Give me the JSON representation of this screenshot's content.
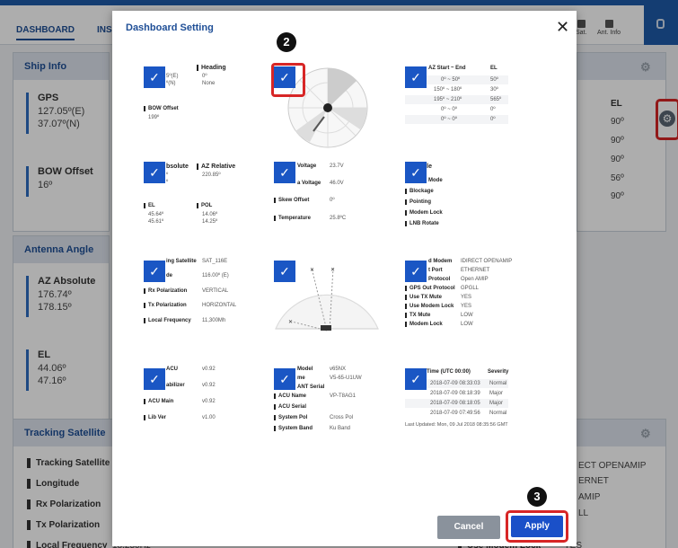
{
  "topbar": {
    "tab_dashboard": "DASHBOARD",
    "tab_ins": "INS",
    "btn_sat": "Sat.",
    "btn_ant_info": "Ant. Info"
  },
  "ship_info": {
    "title": "Ship Info",
    "gps_label": "GPS",
    "gps_lon": "127.05º(E)",
    "gps_lat": "37.07º(N)",
    "bow_label": "BOW Offset",
    "bow_value": "16º"
  },
  "antenna_angle": {
    "title": "Antenna Angle",
    "az_label": "AZ Absolute",
    "az_1": "176.74º",
    "az_2": "178.15º",
    "el_label": "EL",
    "el_1": "44.06º",
    "el_2": "47.16º"
  },
  "el_table": {
    "header": "EL",
    "values": [
      "90º",
      "90º",
      "90º",
      "56º",
      "90º"
    ]
  },
  "tracking_satellite": {
    "title": "Tracking Satellite",
    "labels": [
      "Tracking Satellite",
      "Longitude",
      "Rx Polarization",
      "Tx Polarization",
      "Local Frequency"
    ],
    "partial_value": "18.250Hz",
    "right_values": [
      "ECT OPENAMIP",
      "ERNET",
      "AMIP",
      "LL"
    ],
    "bottom_label": "Use Modem Lock",
    "bottom_value": "YES"
  },
  "modal": {
    "title": "Dashboard Setting",
    "close": "✕",
    "check_glyph": "✓",
    "badge_2": "2",
    "badge_3": "3",
    "cancel": "Cancel",
    "apply": "Apply",
    "card_heading": {
      "heading_label": "Heading",
      "heading_val1": "0º",
      "heading_val2": "None",
      "lat_part1": "5º(E)",
      "lat_part2": "º(N)",
      "bow_label": "BOW Offset",
      "bow_val": "199º"
    },
    "card_azrange": {
      "col1": "AZ Start ~ End",
      "col2": "EL",
      "rows": [
        [
          "0º ~ 50º",
          "50º"
        ],
        [
          "150º ~ 180º",
          "30º"
        ],
        [
          "195º ~ 210º",
          "565º"
        ],
        [
          "0º ~ 0º",
          "0º"
        ],
        [
          "0º ~ 0º",
          "0º"
        ]
      ]
    },
    "card_az": {
      "abs_label": "bsolute",
      "rel_label": "AZ Relative",
      "rel_val": "220.85º",
      "a1": "º",
      "a2": "º",
      "el_label": "EL",
      "el_1": "45.64º",
      "el_2": "45.61º",
      "pol_label": "POL",
      "pol_1": "14.06º",
      "pol_2": "14.25º"
    },
    "card_voltage": {
      "v1_label": "Voltage",
      "v1": "23.7V",
      "v2_label": "a Voltage",
      "v2": "46.0V",
      "skew_label": "Skew Offset",
      "skew": "0º",
      "temp_label": "Temperature",
      "temp": "25.8ºC"
    },
    "card_modes": {
      "m1": "able",
      "m2": "Mode",
      "m3": "Blockage",
      "m4": "Pointing",
      "m5": "Modem Lock",
      "m6": "LNB Rotate"
    },
    "card_sat": {
      "l1": "ing Satellite",
      "v1": "SAT_116E",
      "l2": "de",
      "v2": "116.00º (E)",
      "l3": "Rx Polarization",
      "v3": "VERTICAL",
      "l4": "Tx Polarization",
      "v4": "HORIZONTAL",
      "l5": "Local Frequency",
      "v5": "11,300Mh"
    },
    "card_modem": {
      "l1": "d Modem",
      "v1": "IDIRECT OPENAMIP",
      "l2": "t Port",
      "v2": "ETHERNET",
      "l3": "Protocol",
      "v3": "Open AMIP",
      "l4": "GPS Out Protocol",
      "v4": "GPGLL",
      "l5": "Use TX Mute",
      "v5": "YES",
      "l6": "Use Modem Lock",
      "v6": "YES",
      "l7": "TX Mute",
      "v7": "LOW",
      "l8": "Modem Lock",
      "v8": "LOW"
    },
    "card_acu": {
      "l1": "ACU",
      "v1": "v0.92",
      "l2": "abilizer",
      "v2": "v0.92",
      "l3": "ACU Main",
      "v3": "v0.92",
      "l4": "Lib Ver",
      "v4": "v1.00"
    },
    "card_system": {
      "l1": "Model",
      "v1": "v65NX",
      "l2": "me",
      "v2": "V5-65-U1UW",
      "l3": "ANT Serial",
      "l4": "ACU Name",
      "v4": "VP-T8AG1",
      "l5": "ACU Serial",
      "l6": "System Pol",
      "v6": "Cross Pol",
      "l7": "System Band",
      "v7": "Ku Band"
    },
    "card_events": {
      "col1": "Time (UTC 00:00)",
      "col2": "Severity",
      "rows": [
        [
          "2018-07-09 08:33:03",
          "Normal"
        ],
        [
          "2018-07-09 08:18:39",
          "Major"
        ],
        [
          "2018-07-09 08:18:05",
          "Major"
        ],
        [
          "2018-07-09 07:49:56",
          "Normal"
        ]
      ],
      "footer": "Last Updated: Mon, 09 Jul 2018 08:35:56 GMT"
    }
  }
}
